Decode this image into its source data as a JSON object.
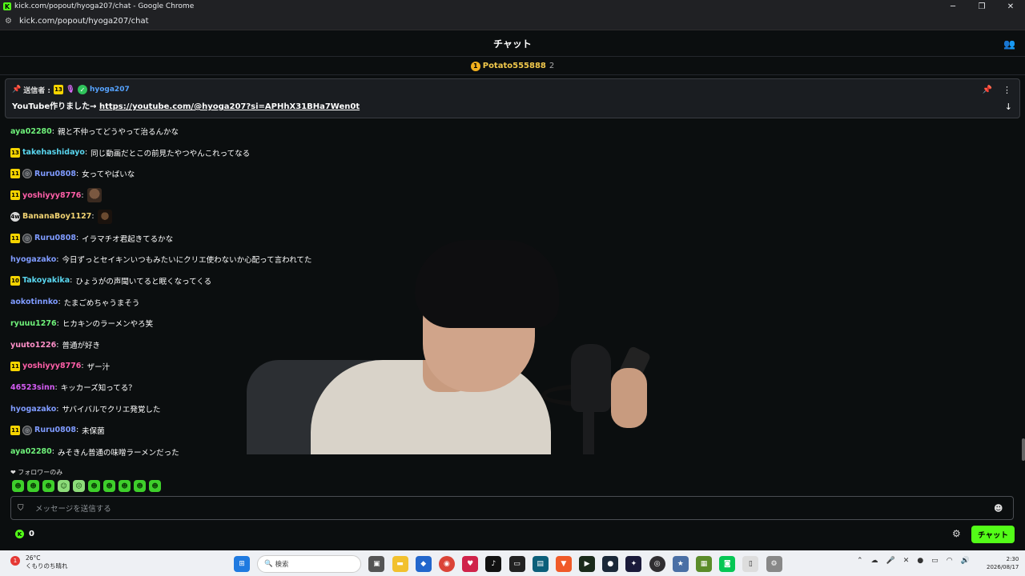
{
  "window": {
    "title": "kick.com/popout/hyoga207/chat - Google Chrome",
    "url": "kick.com/popout/hyoga207/chat",
    "favicon": "K"
  },
  "header": {
    "title": "チャット",
    "icon": "people-icon"
  },
  "leaderboard": {
    "rank": "1",
    "name": "Potato555888",
    "count": "2"
  },
  "pinned": {
    "label": "送信者 :",
    "badge": "13",
    "user": "hyoga207",
    "message": "YouTube作りました→ ",
    "link": "https://youtube.com/@hyoga207?si=APHhX31BHa7Wen0t"
  },
  "messages": [
    {
      "badges": [],
      "user": "aya02280",
      "color": "#6ff27a",
      "text": "親と不仲ってどうやって治るんかな",
      "emote": ""
    },
    {
      "badges": [
        "13"
      ],
      "user": "takehashidayo",
      "color": "#59d5ee",
      "text": "同じ動画だとこの前見たやつやんこれってなる",
      "emote": ""
    },
    {
      "badges": [
        "11",
        "sub"
      ],
      "user": "Ruru0808",
      "color": "#7f9bff",
      "text": "女ってやばいな",
      "emote": ""
    },
    {
      "badges": [
        "11"
      ],
      "user": "yoshiyyy8776",
      "color": "#ff5fa8",
      "text": "",
      "emote": "face1"
    },
    {
      "badges": [
        "4w"
      ],
      "user": "BananaBoy1127",
      "color": "#f0d272",
      "text": "",
      "emote": "face2"
    },
    {
      "badges": [
        "11",
        "sub"
      ],
      "user": "Ruru0808",
      "color": "#7f9bff",
      "text": "イラマチオ君起きてるかな",
      "emote": ""
    },
    {
      "badges": [],
      "user": "hyogazako",
      "color": "#7f9bff",
      "text": "今日ずっとセイキンいつもみたいにクリエ使わないか心配って言われてた",
      "emote": ""
    },
    {
      "badges": [
        "10"
      ],
      "user": "Takoyakika",
      "color": "#59d5ee",
      "text": "ひょうがの声聞いてると眠くなってくる",
      "emote": ""
    },
    {
      "badges": [],
      "user": "aokotinnko",
      "color": "#7f9bff",
      "text": "たまごめちゃうまそう",
      "emote": ""
    },
    {
      "badges": [],
      "user": "ryuuu1276",
      "color": "#6ff27a",
      "text": "ヒカキンのラーメンやろ笑",
      "emote": ""
    },
    {
      "badges": [],
      "user": "yuuto1226",
      "color": "#ff8fc8",
      "text": "普通が好き",
      "emote": ""
    },
    {
      "badges": [
        "11"
      ],
      "user": "yoshiyyy8776",
      "color": "#ff5fa8",
      "text": "ザー汁",
      "emote": ""
    },
    {
      "badges": [],
      "user": "46523sinn",
      "color": "#d35cf2",
      "text": "キッカーズ知ってる？",
      "emote": ""
    },
    {
      "badges": [],
      "user": "hyogazako",
      "color": "#7f9bff",
      "text": "サバイバルでクリエ発覚した",
      "emote": ""
    },
    {
      "badges": [
        "11",
        "sub"
      ],
      "user": "Ruru0808",
      "color": "#7f9bff",
      "text": "未保菌",
      "emote": ""
    },
    {
      "badges": [],
      "user": "aya02280",
      "color": "#6ff27a",
      "text": "みそきん普通の味噌ラーメンだった",
      "emote": ""
    }
  ],
  "follower_label": "フォロワーのみ",
  "input": {
    "placeholder": "メッセージを送信する"
  },
  "footer": {
    "points": "0",
    "send_label": "チャット"
  },
  "taskbar": {
    "temp": "26°C",
    "weather": "くもりのち晴れ",
    "weather_badge": "1",
    "search_placeholder": "検索",
    "time": "2:30",
    "date": "2026/08/17"
  },
  "colors": {
    "accent": "#53fc18",
    "background": "#0b0e0f"
  }
}
